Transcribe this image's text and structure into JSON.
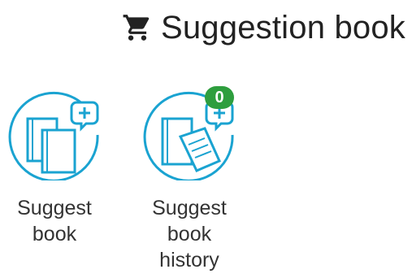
{
  "header": {
    "title": "Suggestion book",
    "icon": "cart-icon"
  },
  "tiles": [
    {
      "label": "Suggest\nbook",
      "icon": "suggest-book-icon"
    },
    {
      "label": "Suggest\nbook\nhistory",
      "icon": "suggest-book-history-icon",
      "badge": "0"
    }
  ],
  "colors": {
    "accent": "#1aa3d1",
    "badge": "#2e9e3e",
    "text": "#333333"
  }
}
